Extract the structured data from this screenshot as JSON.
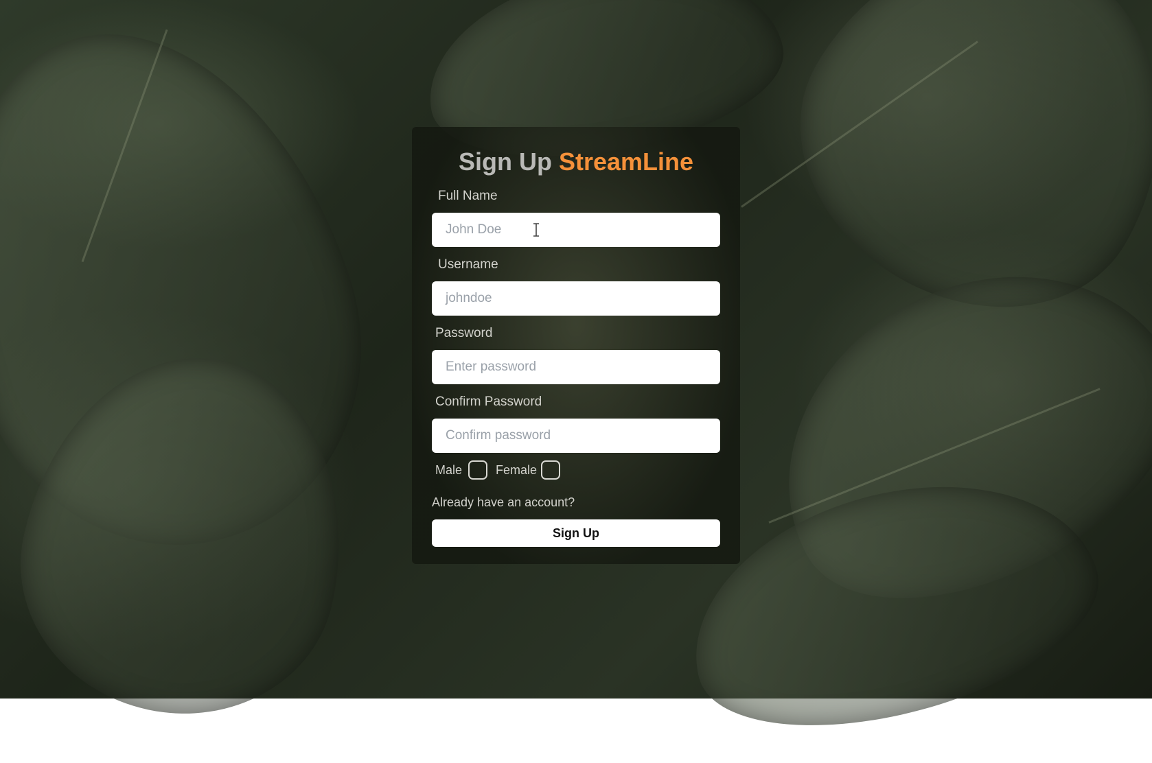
{
  "form": {
    "title_part1": "Sign Up",
    "title_part2": "StreamLine",
    "full_name": {
      "label": "Full Name",
      "placeholder": "John Doe"
    },
    "username": {
      "label": "Username",
      "placeholder": "johndoe"
    },
    "password": {
      "label": "Password",
      "placeholder": "Enter password"
    },
    "confirm_password": {
      "label": "Confirm Password",
      "placeholder": "Confirm password"
    },
    "gender": {
      "male_label": "Male",
      "female_label": "Female"
    },
    "login_link": "Already have an account?",
    "submit_label": "Sign Up"
  },
  "colors": {
    "accent": "#f5913a",
    "title_gray": "#b9b9b6"
  }
}
